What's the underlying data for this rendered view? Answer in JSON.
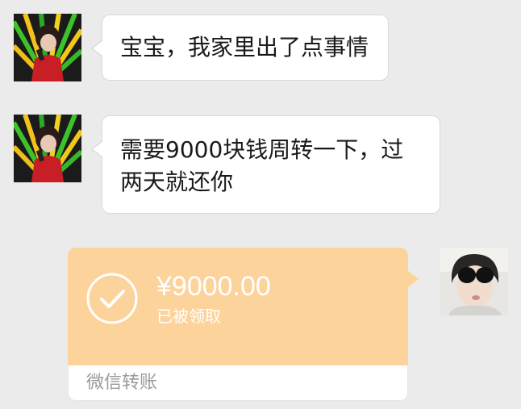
{
  "messages": [
    {
      "sender": "contact",
      "text": "宝宝，我家里出了点事情"
    },
    {
      "sender": "contact",
      "text": "需要9000块钱周转一下，过\n两天就还你"
    }
  ],
  "transfer": {
    "amount": "¥9000.00",
    "status": "已被领取",
    "label": "微信转账"
  },
  "colors": {
    "background": "#ebebeb",
    "bubble": "#ffffff",
    "transfer_card": "#fdd39c",
    "transfer_label": "#9a9a9a"
  },
  "icons": {
    "transfer_status": "checkmark-circle-icon"
  }
}
